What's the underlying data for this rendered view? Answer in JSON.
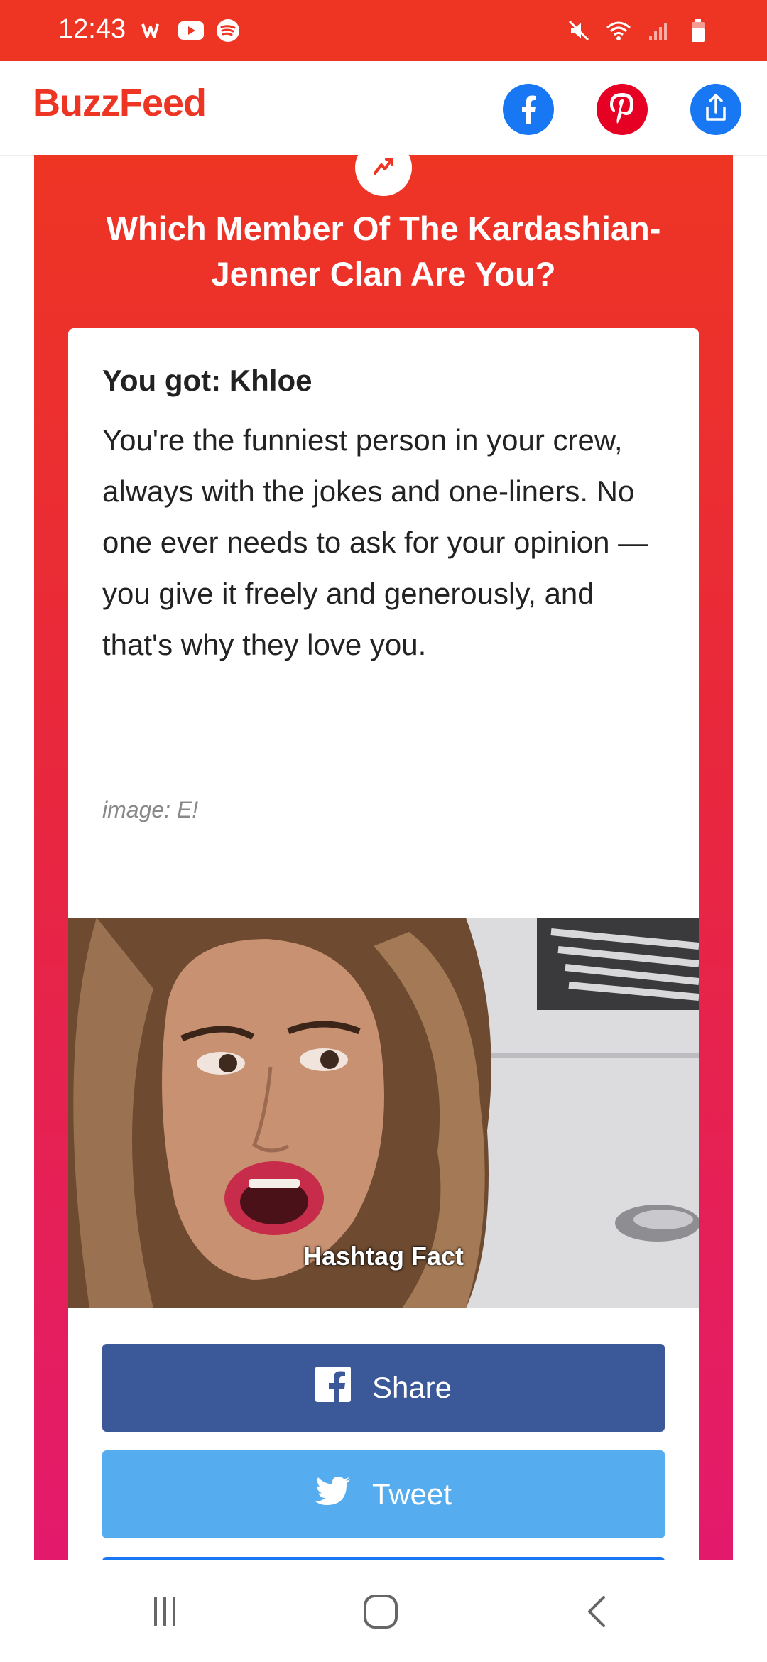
{
  "status_bar": {
    "time": "12:43",
    "left_icons": [
      "webtoon-icon",
      "youtube-icon",
      "spotify-icon"
    ],
    "right_icons": [
      "mute-icon",
      "wifi-icon",
      "signal-icon",
      "battery-icon"
    ]
  },
  "header": {
    "logo": "BuzzFeed",
    "buttons": [
      "facebook-icon",
      "pinterest-icon",
      "share-icon"
    ],
    "colors": {
      "logo": "#ee3524",
      "facebook": "#1877f2",
      "pinterest": "#e60023"
    }
  },
  "quiz": {
    "title": "Which Member Of The Kardashian-Jenner Clan Are You?",
    "result_heading": "You got: Khloe",
    "result_text": "You're the funniest person in your crew, always with the jokes and one-liners. No one ever needs to ask for your opinion — you give it freely and generously, and that's why they love you.",
    "image_credit": "image: E!",
    "image_caption": "Hashtag Fact"
  },
  "share_buttons": {
    "facebook_label": "Share",
    "twitter_label": "Tweet",
    "colors": {
      "facebook": "#3b5998",
      "twitter": "#55acee"
    }
  },
  "nav_bar": {
    "buttons": [
      "recents-icon",
      "home-icon",
      "back-icon"
    ]
  }
}
